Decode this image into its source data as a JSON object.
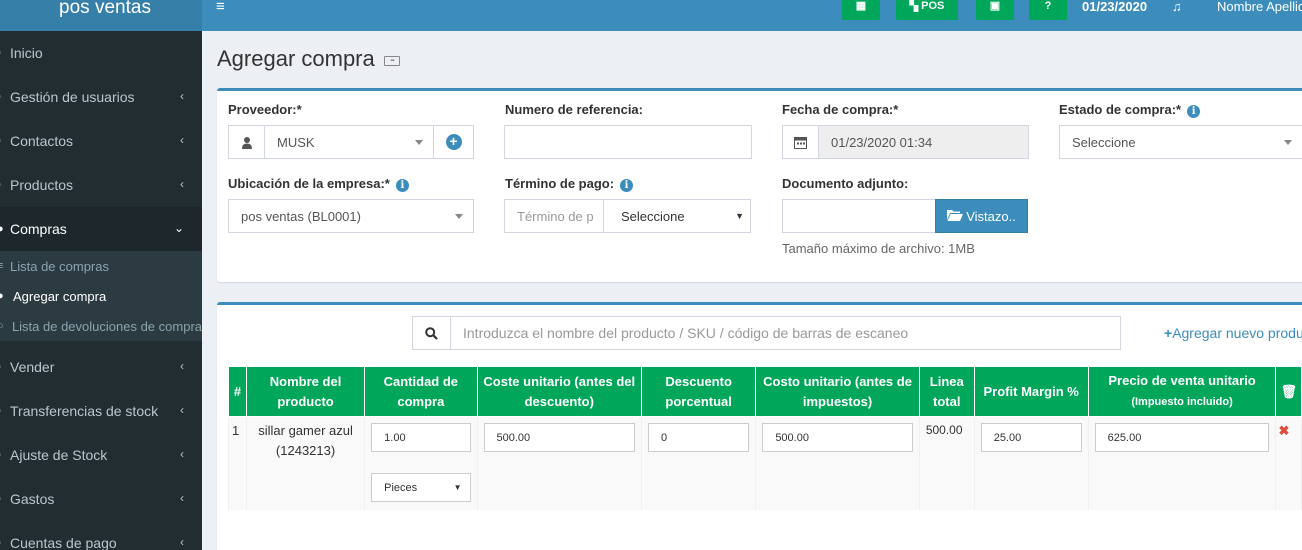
{
  "app": {
    "brand": "pos ventas"
  },
  "sidebar": {
    "items": [
      {
        "label": "Inicio"
      },
      {
        "label": "Gestión de usuarios"
      },
      {
        "label": "Contactos"
      },
      {
        "label": "Productos"
      },
      {
        "label": "Compras"
      },
      {
        "label": "Vender"
      },
      {
        "label": "Transferencias de stock"
      },
      {
        "label": "Ajuste de Stock"
      },
      {
        "label": "Gastos"
      },
      {
        "label": "Cuentas de pago"
      }
    ],
    "submenu": [
      {
        "label": "Lista de compras"
      },
      {
        "label": "Agregar compra"
      },
      {
        "label": "Lista de devoluciones de compra"
      }
    ]
  },
  "header": {
    "pos_label": "POS",
    "date": "01/23/2020",
    "user": "Nombre Apellido"
  },
  "page": {
    "title": "Agregar compra"
  },
  "form": {
    "proveedor_label": "Proveedor:*",
    "proveedor_value": "MUSK",
    "referencia_label": "Numero de referencia:",
    "referencia_value": "",
    "fecha_label": "Fecha de compra:*",
    "fecha_value": "01/23/2020 01:34",
    "estado_label": "Estado de compra:*",
    "estado_value": "Seleccione",
    "ubicacion_label": "Ubicación de la empresa:*",
    "ubicacion_value": "pos ventas (BL0001)",
    "termino_label": "Término de pago:",
    "termino_placeholder": "Término de p",
    "termino_select": "Seleccione",
    "documento_label": "Documento adjunto:",
    "browse_label": "Vistazo..",
    "file_hint": "Tamaño máximo de archivo: 1MB"
  },
  "search": {
    "placeholder": "Introduzca el nombre del producto / SKU / código de barras de escaneo",
    "add_new_label": "Agregar nuevo producto"
  },
  "table": {
    "headers": {
      "num": "#",
      "name": "Nombre del producto",
      "qty": "Cantidad de compra",
      "unit_cost_before": "Coste unitario (antes del descuento)",
      "discount": "Descuento porcentual",
      "unit_cost_tax": "Costo unitario (antes de impuestos)",
      "line_total": "Linea total",
      "margin": "Profit Margin %",
      "sell_price": "Precio de venta unitario",
      "sell_price_sub": "(Impuesto incluido)"
    },
    "rows": [
      {
        "num": "1",
        "name": "sillar gamer azul (1243213)",
        "qty": "1.00",
        "unit": "Pieces",
        "unit_cost_before": "500.00",
        "discount": "0",
        "unit_cost_tax": "500.00",
        "line_total": "500.00",
        "margin": "25.00",
        "sell_price": "625.00"
      }
    ]
  }
}
